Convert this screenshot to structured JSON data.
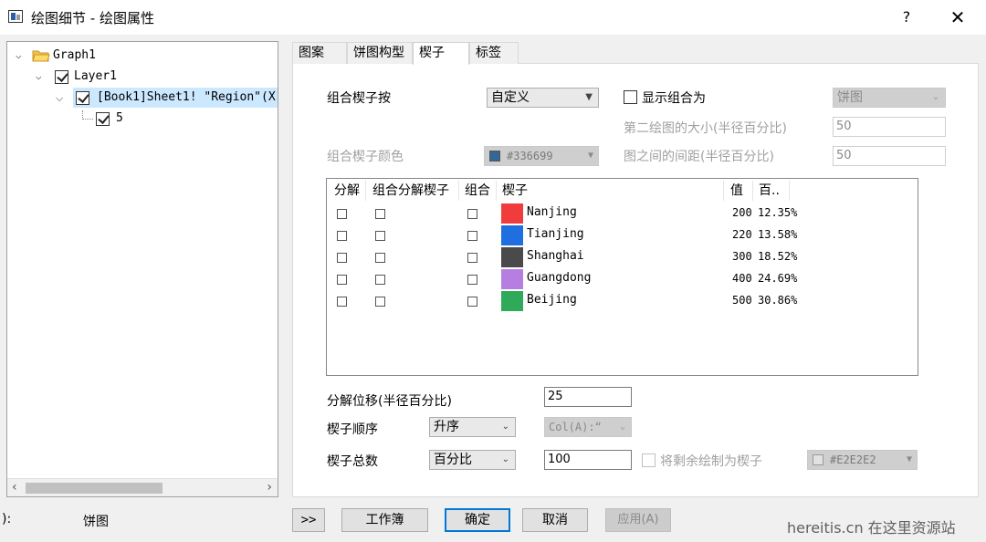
{
  "window": {
    "title": "绘图细节 - 绘图属性",
    "help": "?",
    "close": "✕"
  },
  "tree": {
    "graph": "Graph1",
    "layer": "Layer1",
    "plot": "[Book1]Sheet1! \"Region\"(X",
    "slice": "5"
  },
  "tabs": [
    {
      "label": "图案"
    },
    {
      "label": "饼图构型"
    },
    {
      "label": "楔子",
      "active": true
    },
    {
      "label": "标签"
    }
  ],
  "wedges": {
    "combine_label": "组合楔子按",
    "combine_value": "自定义",
    "color_label": "组合楔子颜色",
    "color_value": "#336699",
    "color_swatch": "#336699",
    "show_combine_label": "显示组合为",
    "show_combine_value": "饼图",
    "second_size_label": "第二绘图的大小(半径百分比)",
    "second_size_value": "50",
    "gap_label": "图之间的间距(半径百分比)",
    "gap_value": "50"
  },
  "list": {
    "headers": [
      "分解",
      "组合分解楔子",
      "组合",
      "楔子",
      "值",
      "百.."
    ],
    "rows": [
      {
        "name": "Nanjing",
        "color": "#f03c3c",
        "value": "200",
        "pct": "12.35%"
      },
      {
        "name": "Tianjing",
        "color": "#1f6fe0",
        "value": "220",
        "pct": "13.58%"
      },
      {
        "name": "Shanghai",
        "color": "#4a4a4a",
        "value": "300",
        "pct": "18.52%"
      },
      {
        "name": "Guangdong",
        "color": "#b57ee0",
        "value": "400",
        "pct": "24.69%"
      },
      {
        "name": "Beijing",
        "color": "#2eaa5a",
        "value": "500",
        "pct": "30.86%"
      }
    ]
  },
  "bottom": {
    "offset_label": "分解位移(半径百分比)",
    "offset_value": "25",
    "order_label": "楔子顺序",
    "order_value": "升序",
    "order_col": "Col(A):“",
    "total_label": "楔子总数",
    "total_value": "百分比",
    "total_number": "100",
    "remain_label": "将剩余绘制为楔子",
    "remain_color": "#E2E2E2"
  },
  "footer": {
    "left_label": "):",
    "plot_type": "饼图",
    "expand": ">>",
    "workbook": "工作簿",
    "ok": "确定",
    "cancel": "取消",
    "apply": "应用(A)"
  },
  "watermark": "hereitis.cn 在这里资源站"
}
